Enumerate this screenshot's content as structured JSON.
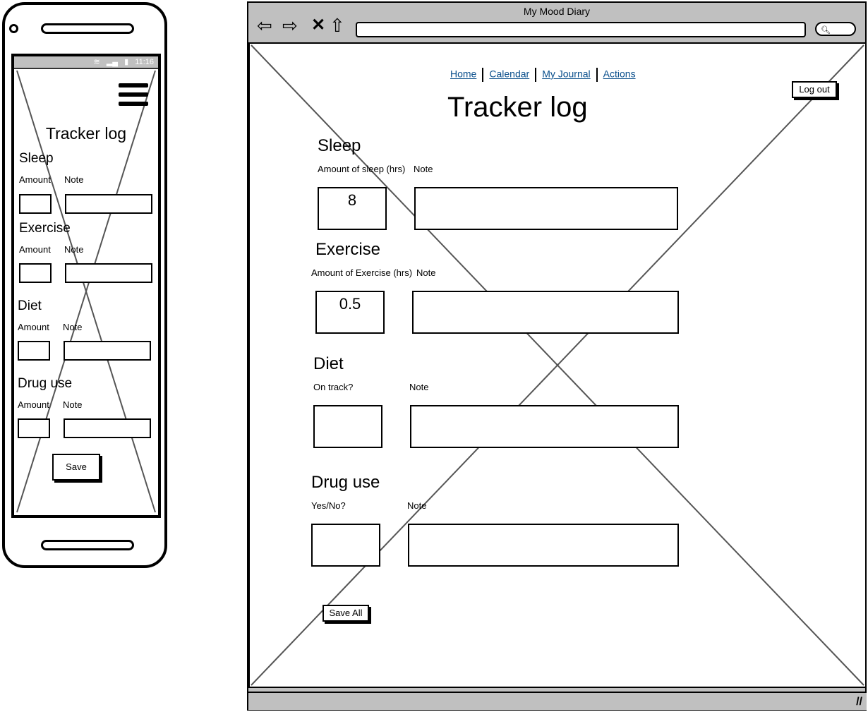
{
  "mobile": {
    "status_bar": {
      "wifi_icon": "wifi-icon",
      "signal_icon": "signal-icon",
      "battery_icon": "battery-icon",
      "time": "11:16"
    },
    "menu_icon": "hamburger-menu-icon",
    "title": "Tracker log",
    "sections": [
      {
        "heading": "Sleep",
        "amount_label": "Amount",
        "note_label": "Note",
        "amount_value": "",
        "note_value": ""
      },
      {
        "heading": "Exercise",
        "amount_label": "Amount",
        "note_label": "Note",
        "amount_value": "",
        "note_value": ""
      },
      {
        "heading": "Diet",
        "amount_label": "Amount",
        "note_label": "Note",
        "amount_value": "",
        "note_value": ""
      },
      {
        "heading": "Drug use",
        "amount_label": "Amount",
        "note_label": "Note",
        "amount_value": "",
        "note_value": ""
      }
    ],
    "save_label": "Save"
  },
  "desktop": {
    "window_title": "My Mood Diary",
    "toolbar": {
      "back_icon": "back-arrow-icon",
      "forward_icon": "forward-arrow-icon",
      "stop_icon": "close-x-icon",
      "home_icon": "home-icon",
      "search_icon": "search-icon",
      "url_value": ""
    },
    "nav": [
      {
        "label": "Home"
      },
      {
        "label": "Calendar"
      },
      {
        "label": "My Journal"
      },
      {
        "label": "Actions"
      }
    ],
    "logout_label": "Log out",
    "title": "Tracker log",
    "sections": [
      {
        "heading": "Sleep",
        "amount_label": "Amount of sleep (hrs)",
        "note_label": "Note",
        "amount_value": "8",
        "note_value": ""
      },
      {
        "heading": "Exercise",
        "amount_label": "Amount of Exercise (hrs)",
        "note_label": "Note",
        "amount_value": "0.5",
        "note_value": ""
      },
      {
        "heading": "Diet",
        "amount_label": "On track?",
        "note_label": "Note",
        "amount_value": "",
        "note_value": ""
      },
      {
        "heading": "Drug use",
        "amount_label": "Yes/No?",
        "note_label": "Note",
        "amount_value": "",
        "note_value": ""
      }
    ],
    "save_all_label": "Save All"
  }
}
